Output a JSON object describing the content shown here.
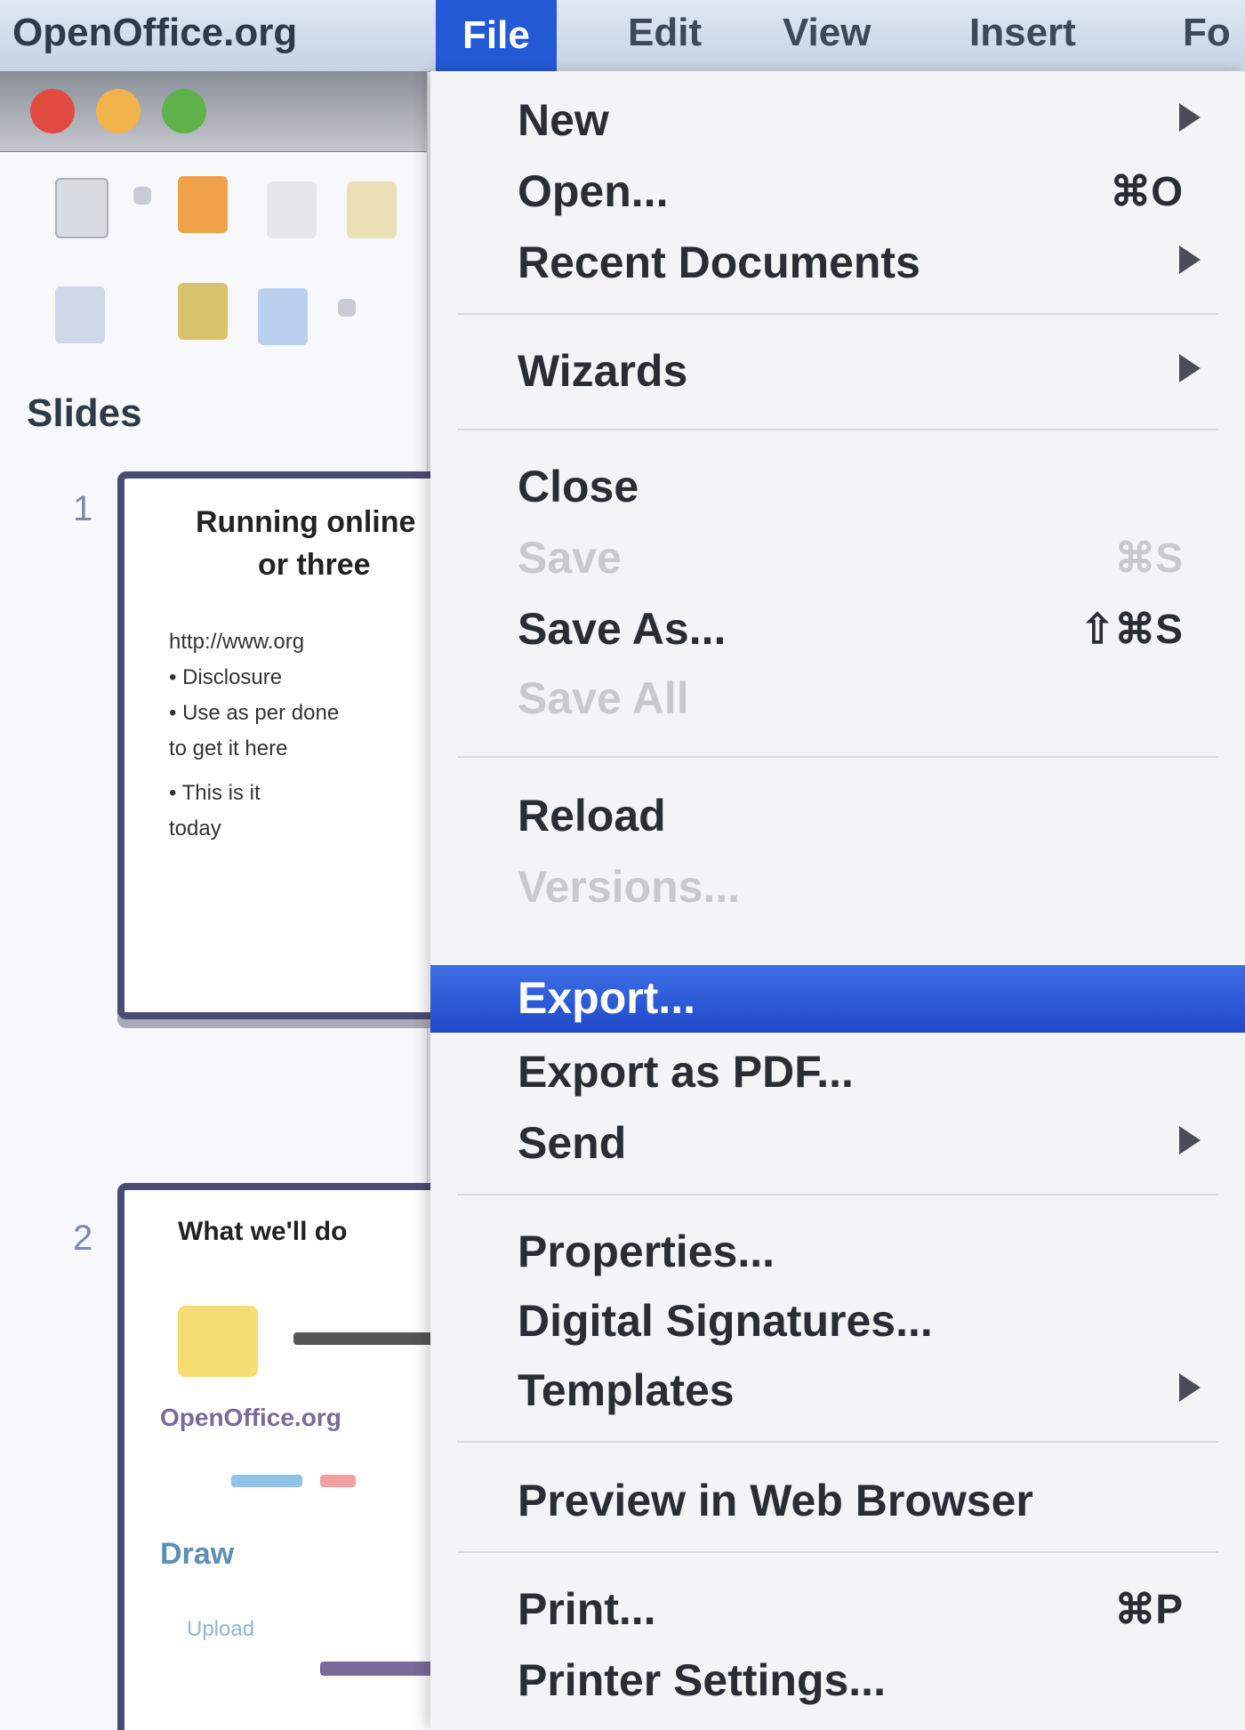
{
  "menubar": {
    "app_name": "OpenOffice.org",
    "items": [
      "File",
      "Edit",
      "View",
      "Insert",
      "Fo"
    ],
    "active": "File"
  },
  "window": {
    "panel_title": "Slides",
    "slides": [
      {
        "number": "1",
        "title_line1": "Running online",
        "title_line2": "or three",
        "body": [
          "http://www.org",
          "• Disclosure",
          "• Use as per done",
          "   to get it here",
          "• This is it",
          "   today"
        ]
      },
      {
        "number": "2",
        "title": "What we'll do",
        "body": [
          "OpenOffice.org",
          "Draw",
          "Upload"
        ]
      }
    ]
  },
  "file_menu": {
    "items": [
      {
        "label": "New",
        "shortcut": "",
        "submenu": true,
        "enabled": true
      },
      {
        "label": "Open...",
        "shortcut": "⌘O",
        "submenu": false,
        "enabled": true
      },
      {
        "label": "Recent Documents",
        "shortcut": "",
        "submenu": true,
        "enabled": true
      },
      {
        "label": "Wizards",
        "shortcut": "",
        "submenu": true,
        "enabled": true
      },
      {
        "label": "Close",
        "shortcut": "",
        "submenu": false,
        "enabled": true
      },
      {
        "label": "Save",
        "shortcut": "⌘S",
        "submenu": false,
        "enabled": false
      },
      {
        "label": "Save As...",
        "shortcut": "⇧⌘S",
        "submenu": false,
        "enabled": true
      },
      {
        "label": "Save All",
        "shortcut": "",
        "submenu": false,
        "enabled": false
      },
      {
        "label": "Reload",
        "shortcut": "",
        "submenu": false,
        "enabled": true
      },
      {
        "label": "Versions...",
        "shortcut": "",
        "submenu": false,
        "enabled": false
      },
      {
        "label": "Export...",
        "shortcut": "",
        "submenu": false,
        "enabled": true,
        "highlighted": true
      },
      {
        "label": "Export as PDF...",
        "shortcut": "",
        "submenu": false,
        "enabled": true
      },
      {
        "label": "Send",
        "shortcut": "",
        "submenu": true,
        "enabled": true
      },
      {
        "label": "Properties...",
        "shortcut": "",
        "submenu": false,
        "enabled": true
      },
      {
        "label": "Digital Signatures...",
        "shortcut": "",
        "submenu": false,
        "enabled": true
      },
      {
        "label": "Templates",
        "shortcut": "",
        "submenu": true,
        "enabled": true
      },
      {
        "label": "Preview in Web Browser",
        "shortcut": "",
        "submenu": false,
        "enabled": true
      },
      {
        "label": "Print...",
        "shortcut": "⌘P",
        "submenu": false,
        "enabled": true
      },
      {
        "label": "Printer Settings...",
        "shortcut": "",
        "submenu": false,
        "enabled": true
      }
    ]
  },
  "colors": {
    "menu_highlight": "#2459d6",
    "slide_border": "#4b4c73"
  }
}
